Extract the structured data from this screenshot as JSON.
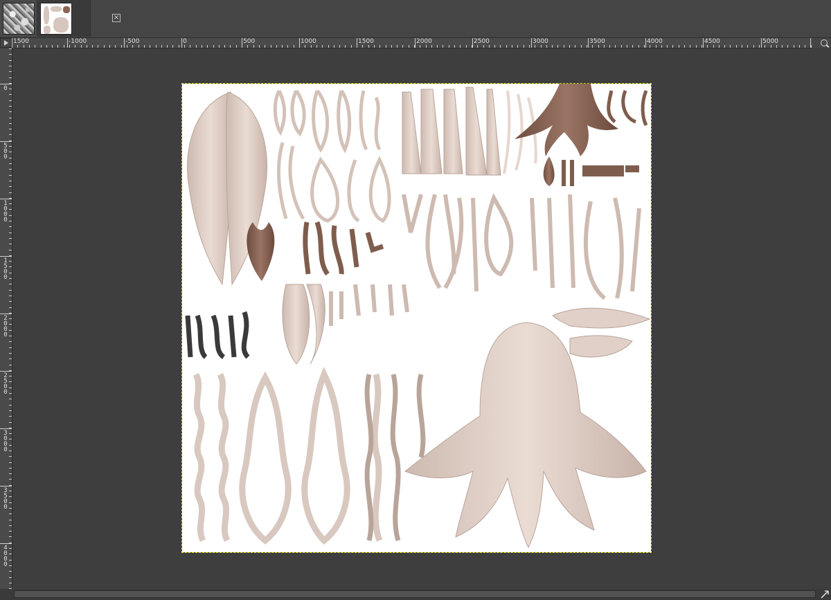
{
  "tabs": [
    {
      "name": "stone-texture",
      "active": false
    },
    {
      "name": "hair-texture",
      "active": true
    }
  ],
  "tab_close_icon": "close-icon",
  "ruler": {
    "horizontal_labels": [
      "1500",
      "-1000",
      "-500",
      "0",
      "500",
      "1000",
      "1500",
      "2000",
      "2500",
      "3000",
      "3500",
      "4000",
      "4500",
      "5000",
      "55"
    ],
    "vertical_labels": [
      "0",
      "500",
      "1000",
      "1500",
      "2000",
      "2500",
      "3000",
      "3500",
      "4000"
    ]
  },
  "icons": {
    "ruler_corner": "triangle-right-icon",
    "zoom": "magnifier-icon",
    "navigate": "navigate-arrows-icon"
  },
  "colors": {
    "hair_light": "#e3d4cb",
    "hair_shade": "#b9a49a",
    "hair_brown": "#7f5d4d",
    "hair_dark": "#3a3a3a",
    "canvas_bg": "#ffffff",
    "workspace_bg": "#3e3e3e",
    "selection_border": "#d8d800"
  }
}
